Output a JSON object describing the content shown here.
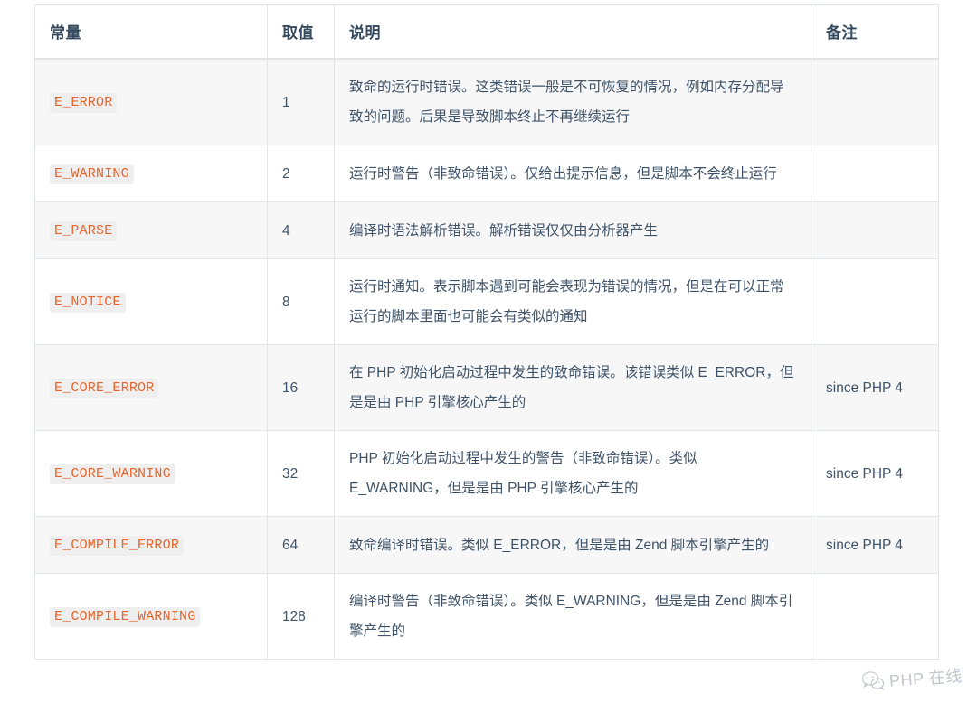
{
  "table": {
    "columns": [
      "常量",
      "取值",
      "说明",
      "备注"
    ],
    "rows": [
      {
        "constant": "E_ERROR",
        "value": "1",
        "description": "致命的运行时错误。这类错误一般是不可恢复的情况，例如内存分配导致的问题。后果是导致脚本终止不再继续运行",
        "remark": ""
      },
      {
        "constant": "E_WARNING",
        "value": "2",
        "description": "运行时警告（非致命错误）。仅给出提示信息，但是脚本不会终止运行",
        "remark": ""
      },
      {
        "constant": "E_PARSE",
        "value": "4",
        "description": "编译时语法解析错误。解析错误仅仅由分析器产生",
        "remark": ""
      },
      {
        "constant": "E_NOTICE",
        "value": "8",
        "description": "运行时通知。表示脚本遇到可能会表现为错误的情况，但是在可以正常运行的脚本里面也可能会有类似的通知",
        "remark": ""
      },
      {
        "constant": "E_CORE_ERROR",
        "value": "16",
        "description": "在 PHP 初始化启动过程中发生的致命错误。该错误类似 E_ERROR，但是是由 PHP 引擎核心产生的",
        "remark": "since PHP 4"
      },
      {
        "constant": "E_CORE_WARNING",
        "value": "32",
        "description": "PHP 初始化启动过程中发生的警告（非致命错误）。类似 E_WARNING，但是是由 PHP 引擎核心产生的",
        "remark": "since PHP 4"
      },
      {
        "constant": "E_COMPILE_ERROR",
        "value": "64",
        "description": "致命编译时错误。类似 E_ERROR，但是是由 Zend 脚本引擎产生的",
        "remark": "since PHP 4"
      },
      {
        "constant": "E_COMPILE_WARNING",
        "value": "128",
        "description": "编译时警告（非致命错误）。类似 E_WARNING，但是是由 Zend 脚本引擎产生的",
        "remark": ""
      }
    ]
  },
  "watermark": {
    "text": "PHP 在线",
    "icon": "wechat-icon"
  },
  "colors": {
    "code_text": "#e8652b",
    "code_background": "#efefef",
    "header_text": "#34495e",
    "body_text": "#3f5368",
    "border": "#e3e6e8",
    "stripe": "#f7f7f8"
  }
}
